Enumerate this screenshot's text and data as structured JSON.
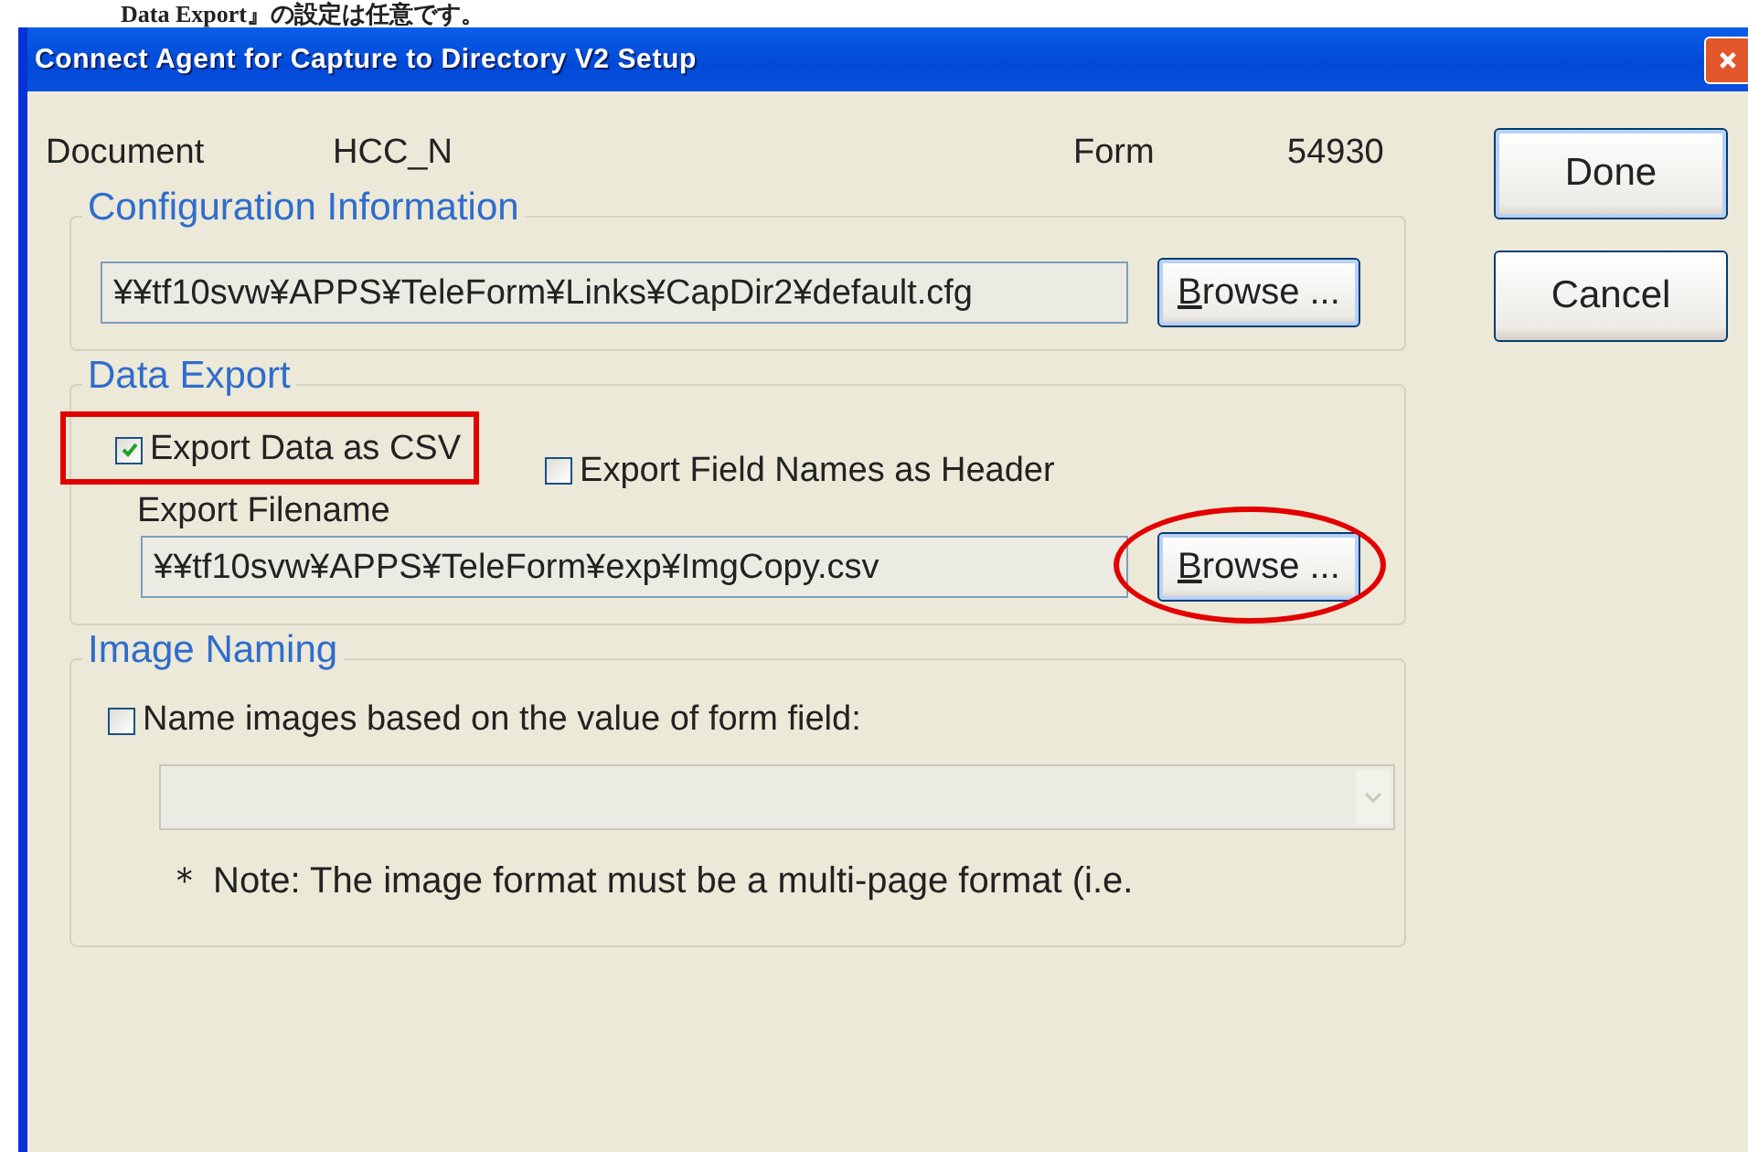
{
  "caption": "Data Export』の設定は任意です。",
  "window": {
    "title": "Connect Agent for Capture to Directory V2 Setup"
  },
  "info": [
    {
      "label": "Document",
      "value": "HCC_N"
    },
    {
      "label": "Form",
      "value": "54930"
    }
  ],
  "buttons": [
    {
      "label": "Done",
      "focused": true
    },
    {
      "label": "Cancel",
      "focused": false
    }
  ],
  "configuration": {
    "title": "Configuration Information",
    "path": "¥¥tf10svw¥APPS¥TeleForm¥Links¥CapDir2¥default.cfg",
    "browse": "Browse ..."
  },
  "data_export": {
    "title": "Data Export",
    "checkboxes": [
      {
        "label": "Export Data as CSV",
        "checked": true,
        "highlighted": true
      },
      {
        "label": "Export Field Names as Header",
        "checked": false
      }
    ],
    "filename_label": "Export Filename",
    "path": "¥¥tf10svw¥APPS¥TeleForm¥exp¥ImgCopy.csv",
    "browse": "Browse ...",
    "browse_highlighted": true
  },
  "image_naming": {
    "title": "Image Naming",
    "checkbox": {
      "label": "Name images based on the value of form field:",
      "checked": false
    },
    "combo": {
      "disabled": true
    },
    "note": "＊ Note: The image format must be a multi-page format (i.e."
  }
}
